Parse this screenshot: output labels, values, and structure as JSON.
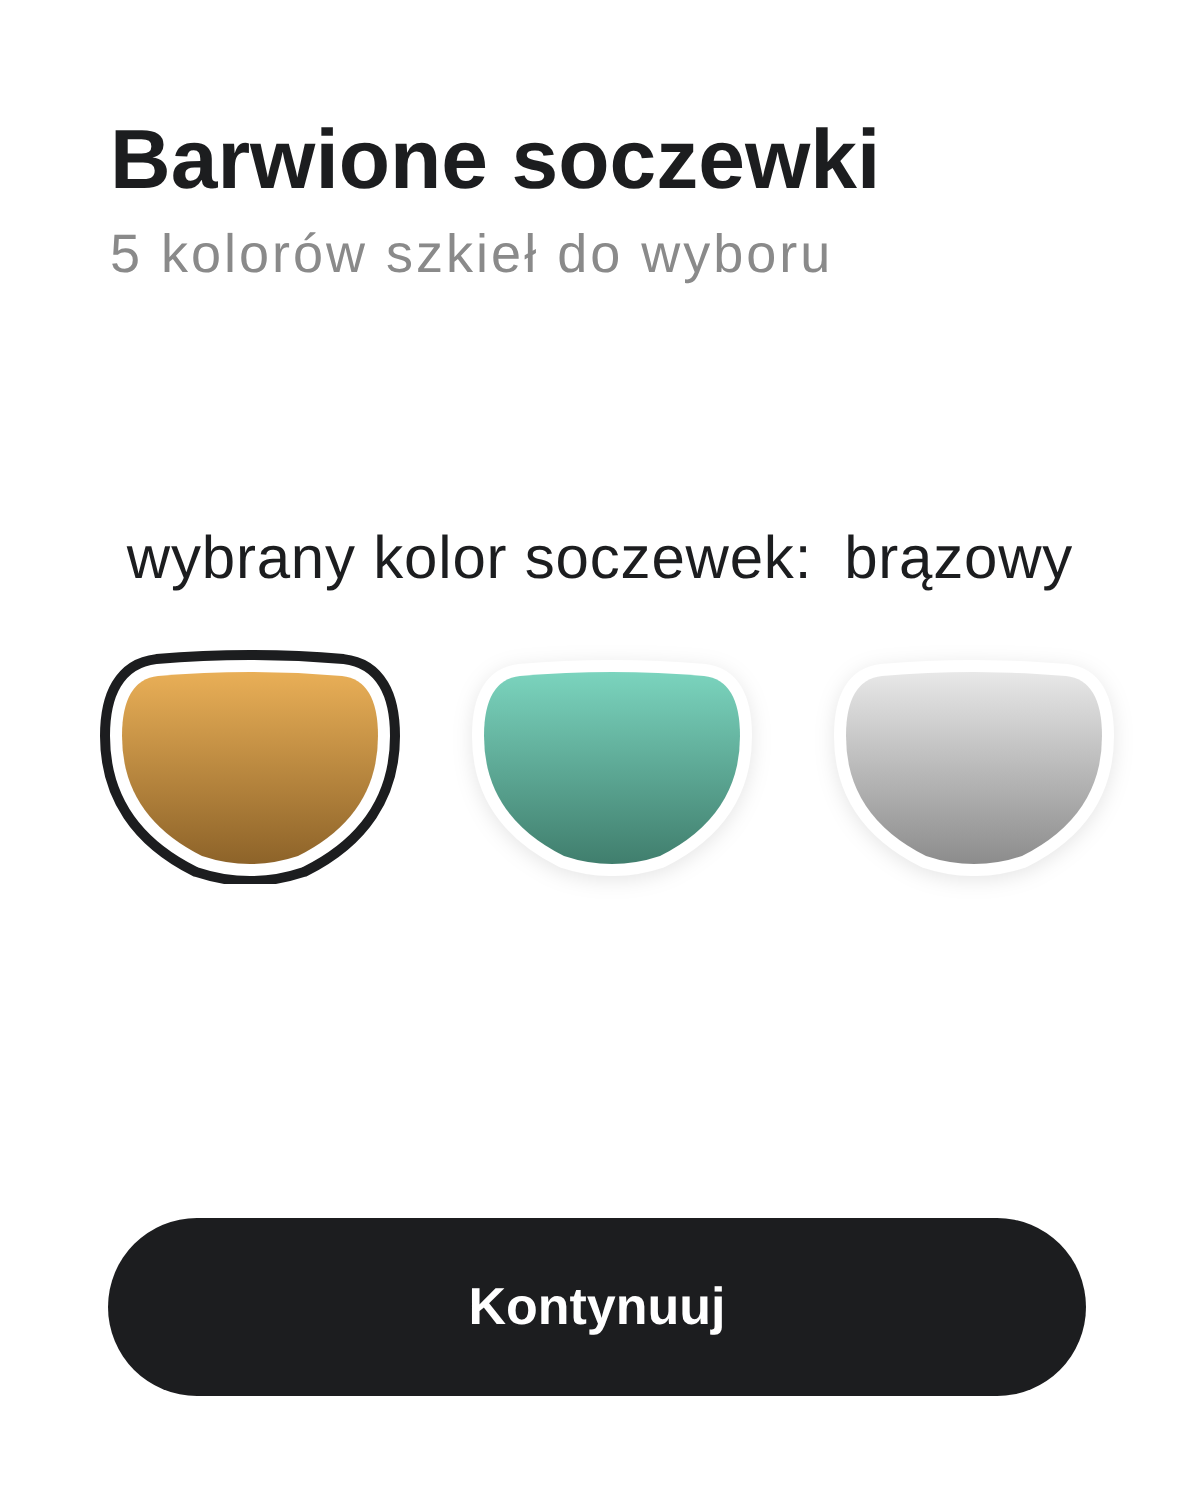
{
  "title": "Barwione soczewki",
  "subtitle": "5 kolorów szkieł do wyboru",
  "selection": {
    "label": "wybrany kolor soczewek:",
    "value": "brązowy"
  },
  "lenses": [
    {
      "selected": true,
      "color": "#e9af57"
    },
    {
      "selected": false,
      "color": "#7bd4be"
    },
    {
      "selected": false,
      "color": "#e8e8e8"
    }
  ],
  "button": {
    "label": "Kontynuuj"
  }
}
